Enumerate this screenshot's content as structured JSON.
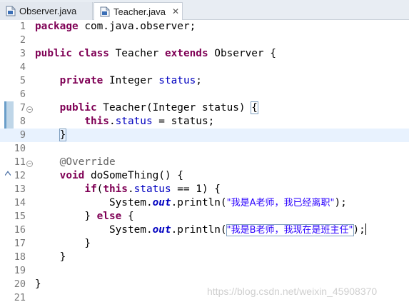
{
  "tabs": [
    {
      "label": "Observer.java",
      "active": false
    },
    {
      "label": "Teacher.java",
      "active": true
    }
  ],
  "close_glyph": "✕",
  "line_numbers": [
    "1",
    "2",
    "3",
    "4",
    "5",
    "6",
    "7",
    "8",
    "9",
    "10",
    "11",
    "12",
    "13",
    "14",
    "15",
    "16",
    "17",
    "18",
    "19",
    "20",
    "21"
  ],
  "code": {
    "l1_kw": "package",
    "l1_rest": " com.java.observer;",
    "l3_kw1": "public",
    "l3_kw2": "class",
    "l3_name": " Teacher ",
    "l3_kw3": "extends",
    "l3_rest": " Observer {",
    "l5_kw": "private",
    "l5_type": " Integer ",
    "l5_field": "status",
    "l5_end": ";",
    "l7_kw": "public",
    "l7_sig": " Teacher(Integer ",
    "l7_param": "status",
    "l7_close": ") ",
    "l7_brace": "{",
    "l8_this": "this",
    "l8_dot": ".",
    "l8_field": "status",
    "l8_rest": " = ",
    "l8_param": "status",
    "l8_end": ";",
    "l9_brace": "}",
    "l11_ann": "@Override",
    "l12_kw": "void",
    "l12_rest": " doSomeThing() {",
    "l13_kw": "if",
    "l13_open": "(",
    "l13_this": "this",
    "l13_dot": ".",
    "l13_field": "status",
    "l13_rest": " == 1) {",
    "l14_sys": "System.",
    "l14_out": "out",
    "l14_mid": ".println(",
    "l14_str": "\"我是A老师，我已经离职\"",
    "l14_end": ");",
    "l15_pre": "} ",
    "l15_kw": "else",
    "l15_rest": " {",
    "l16_sys": "System.",
    "l16_out": "out",
    "l16_mid": ".println(",
    "l16_str": "\"我是B老师，我现在是班主任\"",
    "l16_end": ");",
    "l17": "}",
    "l18": "}",
    "l20": "}"
  },
  "watermark": "https://blog.csdn.net/weixin_45908370"
}
